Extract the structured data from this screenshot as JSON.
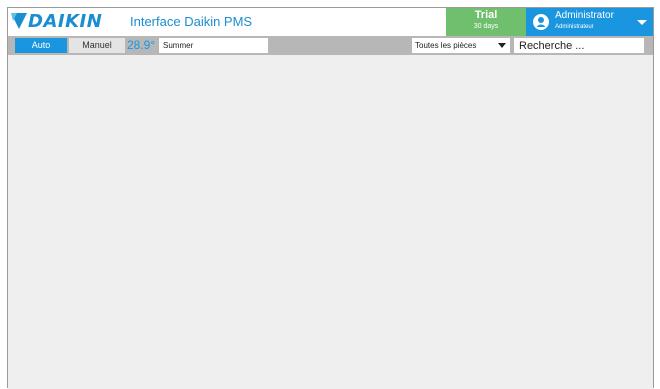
{
  "header": {
    "logo_text": "DAIKIN",
    "app_title": "Interface Daikin PMS",
    "trial": {
      "label": "Trial",
      "days": "30 days"
    },
    "user": {
      "name": "Administrator",
      "role": "Administrateur"
    }
  },
  "toolbar": {
    "mode_auto": "Auto",
    "mode_manual": "Manuel",
    "temperature": "28.9°",
    "season": "Summer",
    "room_filter": "Toutes les pièces",
    "search_placeholder": "Recherche ..."
  },
  "colors": {
    "brand_blue": "#1a96e0",
    "trial_green": "#6fbf6e",
    "toolbar_gray": "#b7b7b7",
    "content_bg": "#efefef"
  }
}
